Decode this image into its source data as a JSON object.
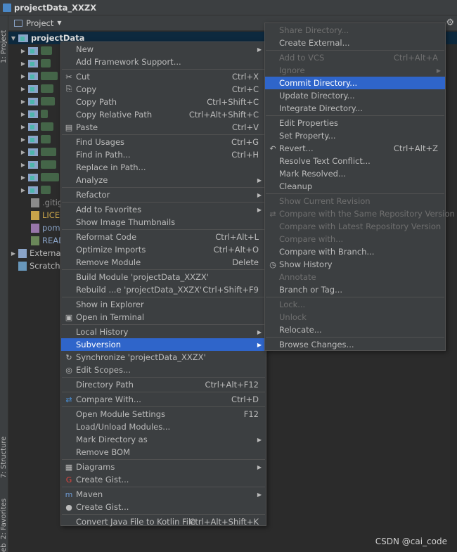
{
  "window": {
    "title": "projectData_XXZX"
  },
  "left_strip": {
    "project_tab": "1: Project",
    "structure_tab": "7: Structure",
    "favorites_tab": "2: Favorites",
    "web_tab": "eb"
  },
  "project_panel": {
    "title": "Project"
  },
  "tree": {
    "root": "projectData",
    "files": [
      ".gitig",
      "LICEN",
      "pom.",
      "READ"
    ],
    "external": "External",
    "scratches": "Scratche"
  },
  "context_menu": {
    "groups": [
      [
        {
          "label": "New",
          "submenu": true
        },
        {
          "label": "Add Framework Support..."
        }
      ],
      [
        {
          "label": "Cut",
          "shortcut": "Ctrl+X",
          "icon": "scissors-icon"
        },
        {
          "label": "Copy",
          "shortcut": "Ctrl+C",
          "icon": "copy-icon"
        },
        {
          "label": "Copy Path",
          "shortcut": "Ctrl+Shift+C"
        },
        {
          "label": "Copy Relative Path",
          "shortcut": "Ctrl+Alt+Shift+C"
        },
        {
          "label": "Paste",
          "shortcut": "Ctrl+V",
          "icon": "paste-icon"
        }
      ],
      [
        {
          "label": "Find Usages",
          "shortcut": "Ctrl+G"
        },
        {
          "label": "Find in Path...",
          "shortcut": "Ctrl+H"
        },
        {
          "label": "Replace in Path..."
        },
        {
          "label": "Analyze",
          "submenu": true
        }
      ],
      [
        {
          "label": "Refactor",
          "submenu": true
        }
      ],
      [
        {
          "label": "Add to Favorites",
          "submenu": true
        },
        {
          "label": "Show Image Thumbnails"
        }
      ],
      [
        {
          "label": "Reformat Code",
          "shortcut": "Ctrl+Alt+L"
        },
        {
          "label": "Optimize Imports",
          "shortcut": "Ctrl+Alt+O"
        },
        {
          "label": "Remove Module",
          "shortcut": "Delete"
        }
      ],
      [
        {
          "label": "Build Module 'projectData_XXZX'"
        },
        {
          "label": "Rebuild ...e 'projectData_XXZX'",
          "shortcut": "Ctrl+Shift+F9"
        }
      ],
      [
        {
          "label": "Show in Explorer"
        },
        {
          "label": "Open in Terminal",
          "icon": "terminal-icon"
        }
      ],
      [
        {
          "label": "Local History",
          "submenu": true
        },
        {
          "label": "Subversion",
          "submenu": true,
          "highlighted": true
        },
        {
          "label": "Synchronize 'projectData_XXZX'",
          "icon": "sync-icon"
        },
        {
          "label": "Edit Scopes...",
          "icon": "scopes-icon"
        }
      ],
      [
        {
          "label": "Directory Path",
          "shortcut": "Ctrl+Alt+F12"
        }
      ],
      [
        {
          "label": "Compare With...",
          "shortcut": "Ctrl+D",
          "icon": "compare-icon"
        }
      ],
      [
        {
          "label": "Open Module Settings",
          "shortcut": "F12"
        },
        {
          "label": "Load/Unload Modules..."
        },
        {
          "label": "Mark Directory as",
          "submenu": true
        },
        {
          "label": "Remove BOM"
        }
      ],
      [
        {
          "label": "Diagrams",
          "submenu": true,
          "icon": "diagram-icon"
        },
        {
          "label": "Create Gist...",
          "icon": "gist-icon"
        }
      ],
      [
        {
          "label": "Maven",
          "submenu": true,
          "icon": "maven-icon"
        },
        {
          "label": "Create Gist...",
          "icon": "github-icon"
        }
      ],
      [
        {
          "label": "Convert Java File to Kotlin File",
          "shortcut": "Ctrl+Alt+Shift+K"
        }
      ]
    ]
  },
  "subversion_menu": {
    "groups": [
      [
        {
          "label": "Share Directory...",
          "disabled": true
        },
        {
          "label": "Create External..."
        }
      ],
      [
        {
          "label": "Add to VCS",
          "shortcut": "Ctrl+Alt+A",
          "disabled": true
        },
        {
          "label": "Ignore",
          "submenu": true,
          "disabled": true
        },
        {
          "label": "Commit Directory...",
          "highlighted": true
        },
        {
          "label": "Update Directory..."
        },
        {
          "label": "Integrate Directory..."
        }
      ],
      [
        {
          "label": "Edit Properties"
        },
        {
          "label": "Set Property..."
        },
        {
          "label": "Revert...",
          "shortcut": "Ctrl+Alt+Z",
          "icon": "revert-icon"
        },
        {
          "label": "Resolve Text Conflict..."
        },
        {
          "label": "Mark Resolved..."
        },
        {
          "label": "Cleanup"
        }
      ],
      [
        {
          "label": "Show Current Revision",
          "disabled": true
        },
        {
          "label": "Compare with the Same Repository Version",
          "disabled": true,
          "icon": "compare-icon"
        },
        {
          "label": "Compare with Latest Repository Version",
          "disabled": true
        },
        {
          "label": "Compare with...",
          "disabled": true
        },
        {
          "label": "Compare with Branch..."
        },
        {
          "label": "Show History",
          "icon": "clock-icon"
        },
        {
          "label": "Annotate",
          "disabled": true
        },
        {
          "label": "Branch or Tag..."
        }
      ],
      [
        {
          "label": "Lock...",
          "disabled": true
        },
        {
          "label": "Unlock",
          "disabled": true
        },
        {
          "label": "Relocate..."
        }
      ],
      [
        {
          "label": "Browse Changes..."
        }
      ]
    ]
  },
  "watermark": "CSDN @cai_code",
  "colors": {
    "highlight": "#2f65ca",
    "menu_bg": "#3c3f41",
    "editor_bg": "#2b2b2b"
  }
}
